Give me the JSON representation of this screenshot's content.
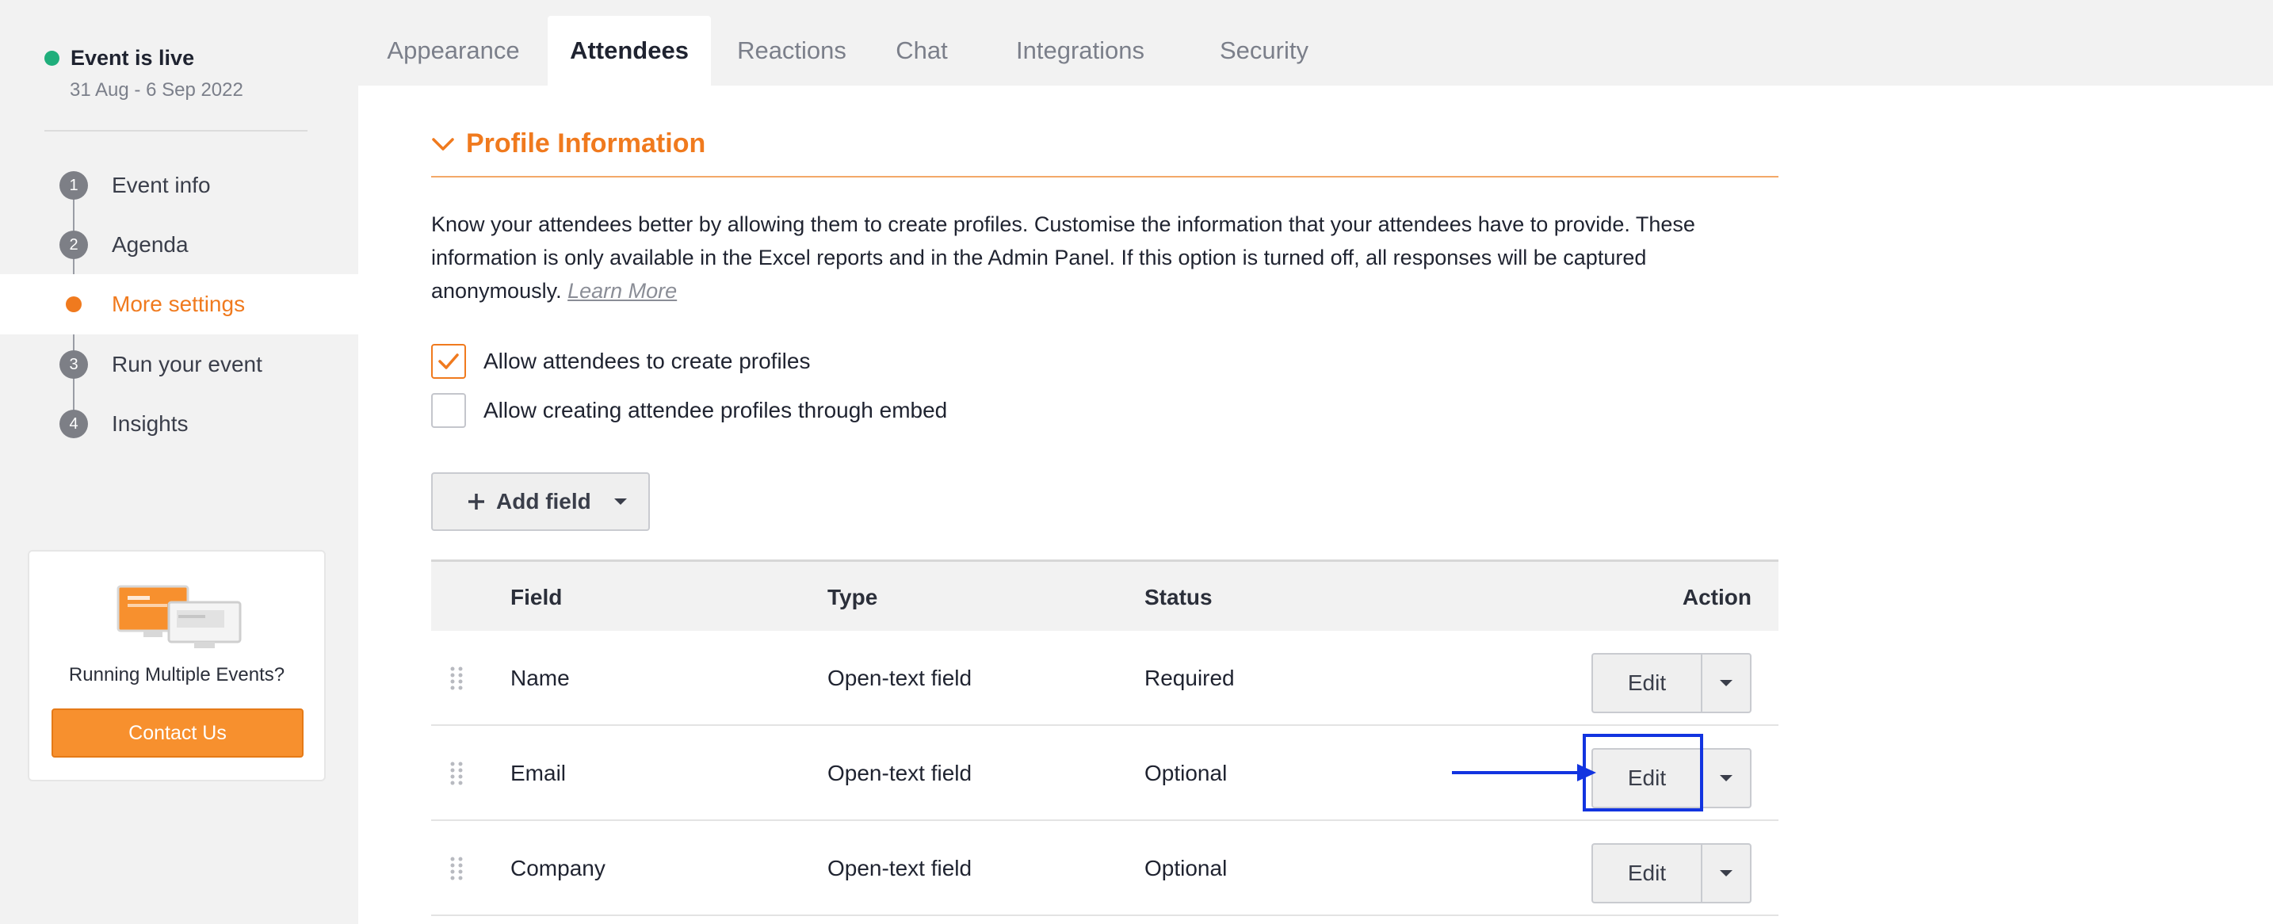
{
  "sidebar": {
    "status": "Event is live",
    "dates": "31 Aug - 6 Sep 2022",
    "steps": [
      {
        "num": "1",
        "label": "Event info"
      },
      {
        "num": "2",
        "label": "Agenda"
      },
      {
        "num": "",
        "label": "More settings"
      },
      {
        "num": "3",
        "label": "Run your event"
      },
      {
        "num": "4",
        "label": "Insights"
      }
    ],
    "promo": {
      "text": "Running Multiple Events?",
      "button": "Contact Us"
    }
  },
  "tabs": [
    "Appearance",
    "Attendees",
    "Reactions",
    "Chat",
    "Integrations",
    "Security"
  ],
  "active_tab": "Attendees",
  "section": {
    "title": "Profile Information",
    "description": "Know your attendees better by allowing them to create profiles. Customise the information that your attendees have to provide. These information is only available in the Excel reports and in the Admin Panel. If this option is turned off, all responses will be captured anonymously.",
    "learn_more": "Learn More",
    "options": [
      {
        "label": "Allow attendees to create profiles",
        "checked": true
      },
      {
        "label": "Allow creating attendee profiles through embed",
        "checked": false
      }
    ],
    "add_field_label": "Add field"
  },
  "table": {
    "headers": {
      "field": "Field",
      "type": "Type",
      "status": "Status",
      "action": "Action"
    },
    "rows": [
      {
        "field": "Name",
        "type": "Open-text field",
        "status": "Required",
        "action": "Edit"
      },
      {
        "field": "Email",
        "type": "Open-text field",
        "status": "Optional",
        "action": "Edit"
      },
      {
        "field": "Company",
        "type": "Open-text field",
        "status": "Optional",
        "action": "Edit"
      }
    ]
  },
  "colors": {
    "accent": "#f07a1e",
    "live": "#1fae7b",
    "annotation": "#1234e0"
  }
}
